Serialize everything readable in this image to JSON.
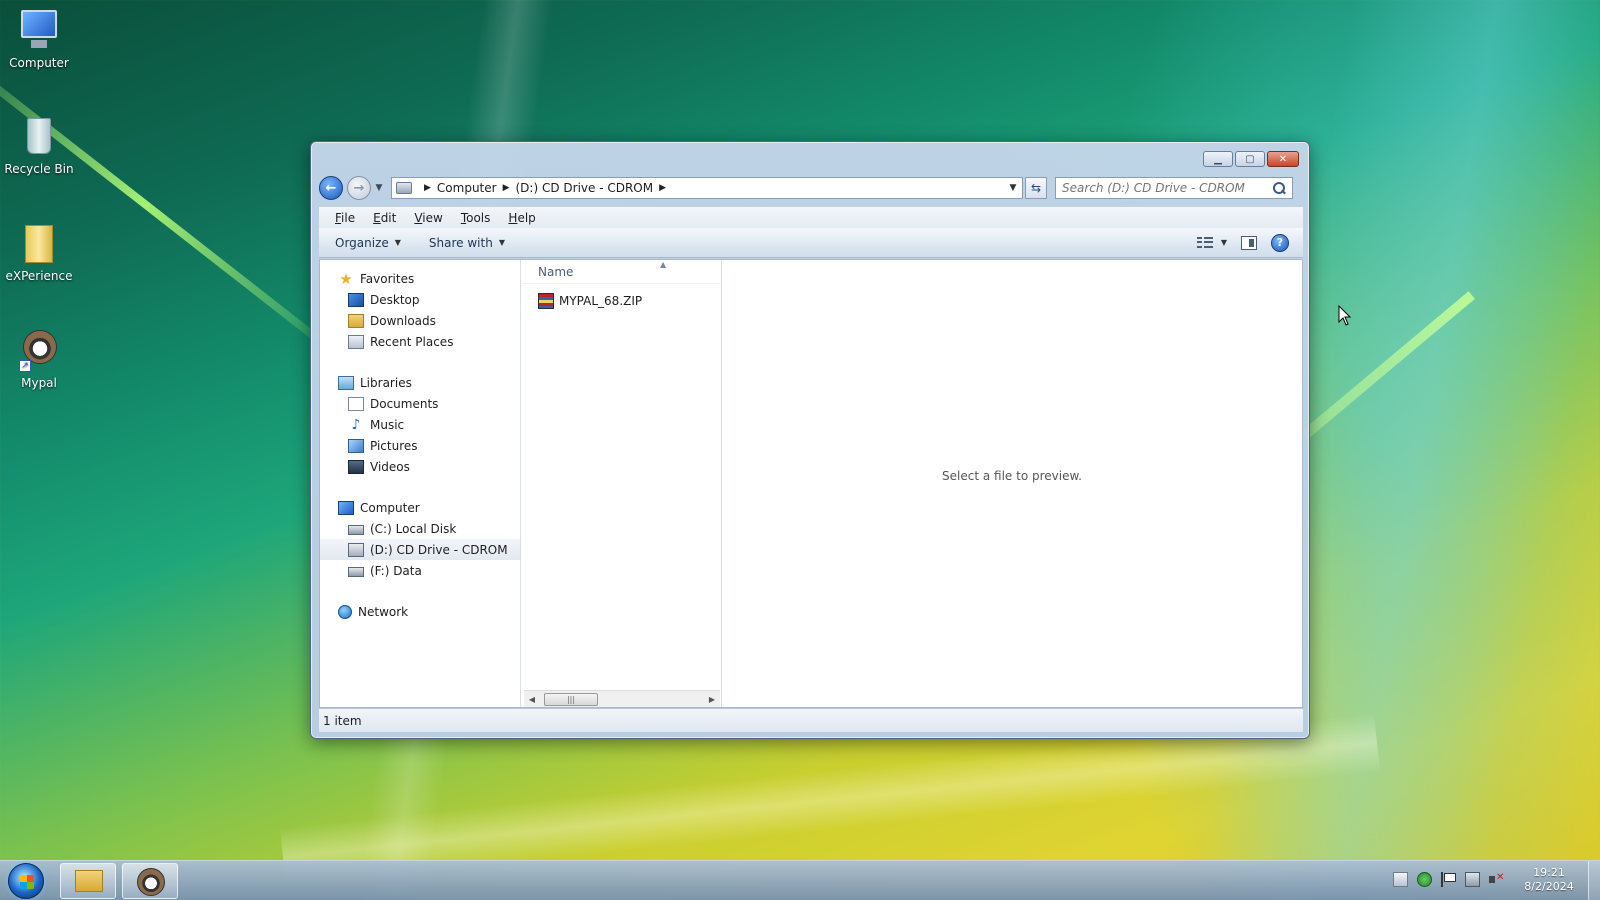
{
  "desktop": {
    "icons": [
      {
        "label": "Computer",
        "icon": "computer-icon"
      },
      {
        "label": "Recycle Bin",
        "icon": "recycle-bin-icon"
      },
      {
        "label": "eXPerience",
        "icon": "folder-icon"
      },
      {
        "label": "Mypal",
        "icon": "mypal-icon"
      }
    ]
  },
  "window": {
    "address": {
      "segments": [
        "Computer",
        "(D:) CD Drive - CDROM"
      ]
    },
    "search": {
      "placeholder": "Search (D:) CD Drive - CDROM"
    },
    "menu": [
      "File",
      "Edit",
      "View",
      "Tools",
      "Help"
    ],
    "commands": {
      "organize": "Organize",
      "share_with": "Share with"
    },
    "nav": {
      "favorites": {
        "label": "Favorites",
        "items": [
          "Desktop",
          "Downloads",
          "Recent Places"
        ]
      },
      "libraries": {
        "label": "Libraries",
        "items": [
          "Documents",
          "Music",
          "Pictures",
          "Videos"
        ]
      },
      "computer": {
        "label": "Computer",
        "items": [
          "(C:) Local Disk",
          "(D:) CD Drive - CDROM",
          "(F:) Data"
        ],
        "selected": "(D:) CD Drive - CDROM"
      },
      "network": {
        "label": "Network"
      }
    },
    "files": {
      "column_header": "Name",
      "items": [
        {
          "name": "MYPAL_68.ZIP",
          "icon": "zip-archive-icon"
        }
      ]
    },
    "preview": {
      "message": "Select a file to preview."
    },
    "status": {
      "item_count": "1 item"
    }
  },
  "taskbar": {
    "clock": {
      "time": "19:21",
      "date": "8/2/2024"
    }
  }
}
